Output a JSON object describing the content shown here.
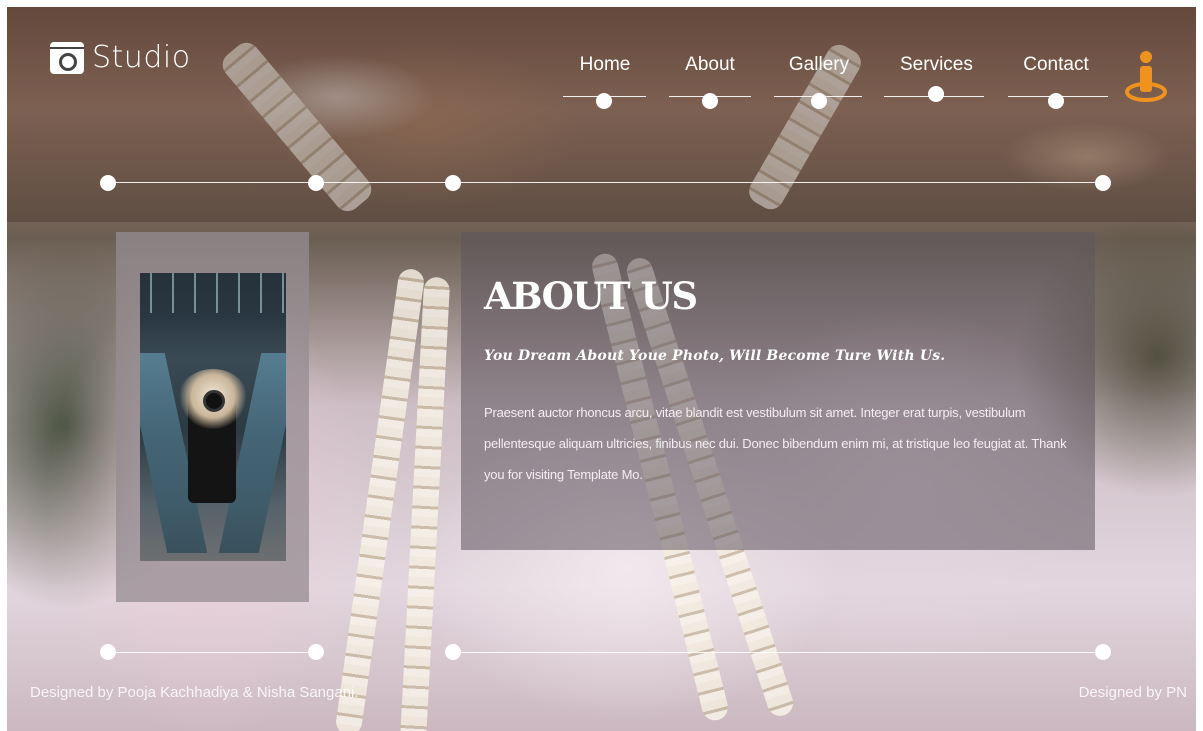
{
  "header": {
    "logo_text": "Studio",
    "logo_icon": "camera-icon",
    "nav": [
      {
        "label": "Home"
      },
      {
        "label": "About"
      },
      {
        "label": "Gallery"
      },
      {
        "label": "Services"
      },
      {
        "label": "Contact"
      }
    ],
    "user_icon": "person-icon"
  },
  "about": {
    "title": "ABOUT US",
    "subtitle": "You Dream About Youe Photo, Will Become Ture With Us.",
    "body": "Praesent auctor rhoncus arcu, vitae blandit est vestibulum sit amet. Integer erat turpis, vestibulum pellentesque aliquam ultricies, finibus nec dui. Donec bibendum enim mi, at tristique leo feugiat at. Thank you for visiting Template Mo."
  },
  "footer": {
    "left": "Designed by Pooja Kachhadiya & Nisha Sangani.",
    "right": "Designed by PN"
  },
  "colors": {
    "accent_orange": "#f0921e",
    "panel_overlay": "#5f555f"
  }
}
